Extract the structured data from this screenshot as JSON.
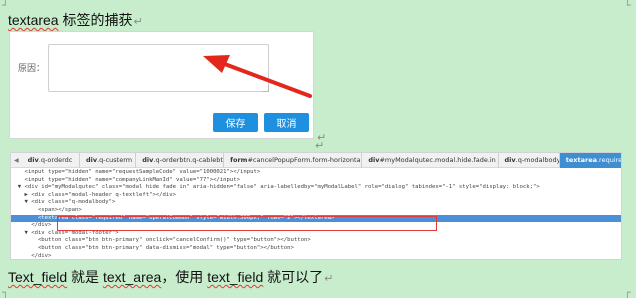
{
  "doc": {
    "heading": {
      "before": "textarea",
      "after": " 标签的捕获"
    },
    "footer": {
      "w1": "Text_field",
      "t1": " 就是 ",
      "w2": "text_area",
      "t2": "，使用 ",
      "w3": "text_field",
      "t3": " 就可以了"
    },
    "paragraph_mark": "↵"
  },
  "form": {
    "reason_label": "原因：",
    "textarea_value": "",
    "save_label": "保存",
    "cancel_label": "取消"
  },
  "devtools": {
    "breadcrumbs": [
      {
        "tag": "div",
        "rest": ".q-orderdc"
      },
      {
        "tag": "div",
        "rest": ".q-custerm"
      },
      {
        "tag": "div",
        "rest": ".q-orderbtn.q-cablebtn"
      },
      {
        "tag": "form",
        "rest": "#cancelPopupForm.form-horizontal"
      },
      {
        "tag": "div",
        "rest": "#myModalqutec.modal.hide.fade.in"
      },
      {
        "tag": "div",
        "rest": ".q-modalbody"
      },
      {
        "tag": "textarea",
        "rest": ".required"
      }
    ],
    "lines": [
      "    <input type=\"hidden\" name=\"requestSampleCode\" value=\"1000021\"></input>",
      "    <input type=\"hidden\" name=\"companyLinkManId\" value=\"77\"></input>",
      "  ▼ <div id=\"myModalqutec\" class=\"modal hide fade in\" aria-hidden=\"false\" aria-labelledby=\"myModalLabel\" role=\"dialog\" tabindex=\"-1\" style=\"display: block;\">",
      "    ▶ <div class=\"modal-header q-textleft\"></div>",
      "    ▼ <div class=\"q-modalbody\">",
      "        <span></span>",
      "        <textarea class=\"required\" name=\"operatCommon\" style=\"width:300px;\" rows=\"2\"></textarea>",
      "      </div>",
      "    ▼ <div class=\"modal-footer\">",
      "        <button class=\"btn btn-primary\" onclick=\"cancelConfirm()\" type=\"button\"></button>",
      "        <button class=\"btn btn-primary\" data-dismiss=\"modal\" type=\"button\"></button>",
      "      </div>"
    ],
    "selected_line_index": 6
  },
  "colors": {
    "page_background": "#c7edcc",
    "button_blue": "#1f8fe0",
    "arrow_red": "#e3271d",
    "selection_blue": "#4a90d9",
    "highlight_box_red": "#e03a3a"
  },
  "icons": {
    "arrow": "red-arrow-icon",
    "paragraph_mark": "return-arrow-icon",
    "corner_marks": "crop-mark-icon"
  }
}
